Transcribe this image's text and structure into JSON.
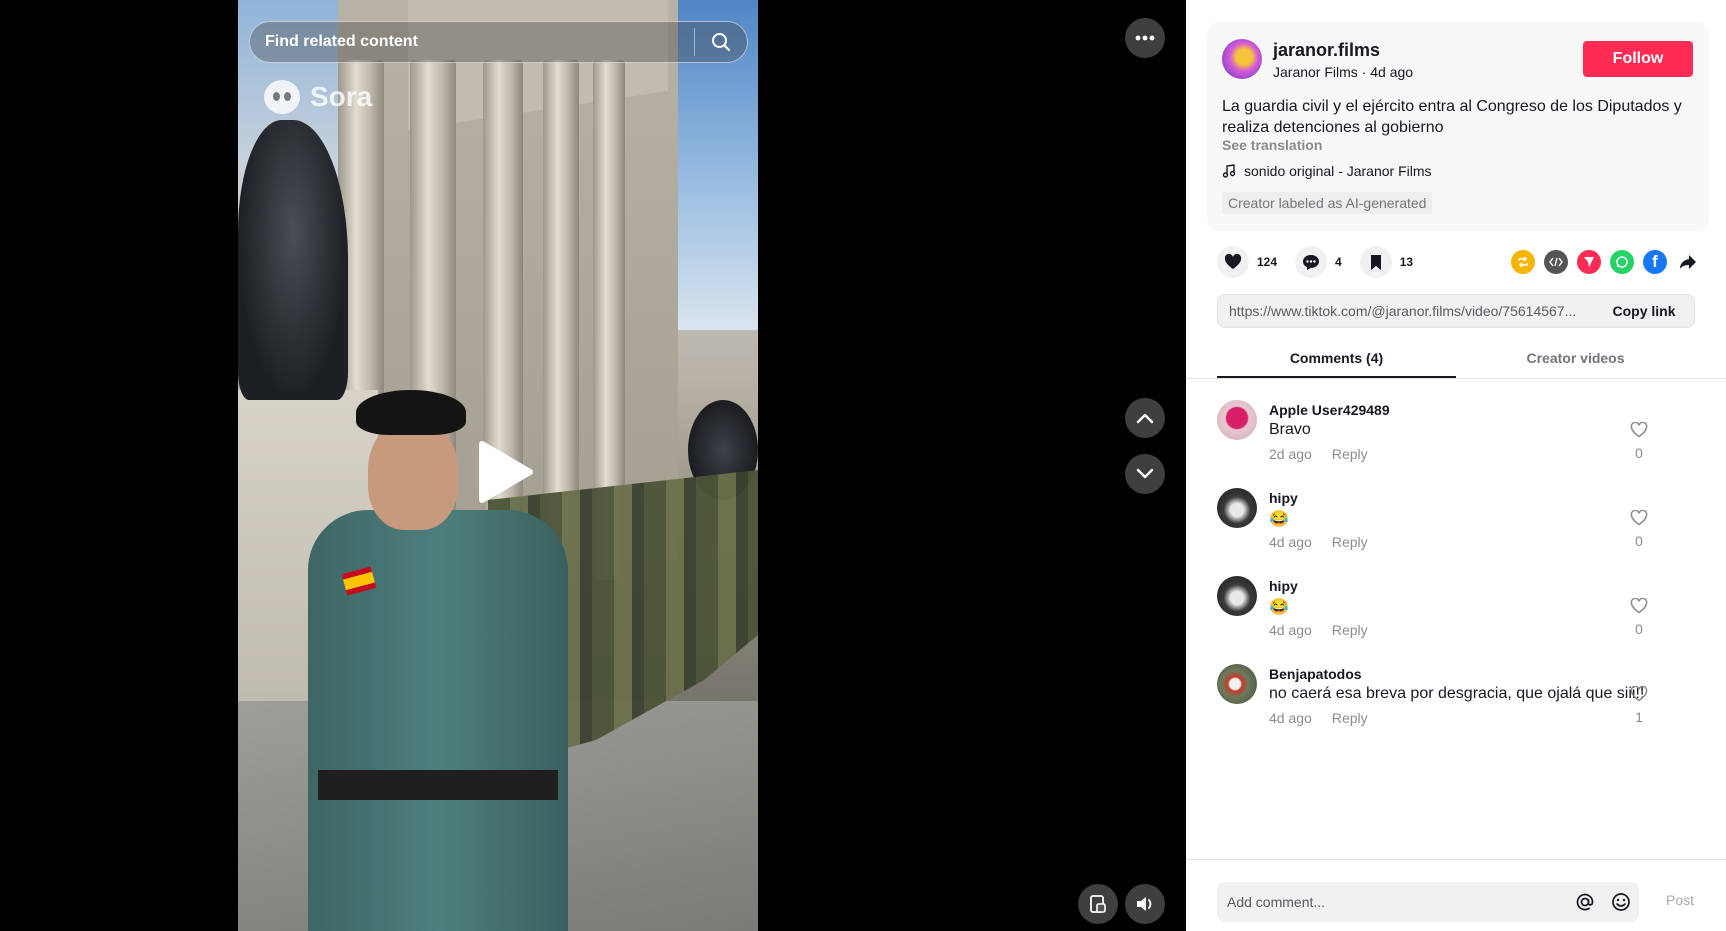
{
  "video": {
    "search_placeholder": "Find related content",
    "watermark": "Sora",
    "controls": {
      "more": "more-options",
      "prev": "previous-video",
      "next": "next-video",
      "pip": "picture-in-picture",
      "volume": "volume"
    }
  },
  "author": {
    "username": "jaranor.films",
    "meta": "Jaranor Films · 4d ago",
    "follow_label": "Follow"
  },
  "post": {
    "description": "La guardia civil y el ejército entra al Congreso de los Diputados y realiza detenciones al gobierno",
    "see_translation": "See translation",
    "music": "sonido original - Jaranor Films",
    "ai_label": "Creator labeled as AI-generated"
  },
  "stats": {
    "likes": "124",
    "comments": "4",
    "saves": "13"
  },
  "share": {
    "icons": [
      "repost-icon",
      "embed-icon",
      "send-icon",
      "whatsapp-icon",
      "facebook-icon",
      "share-arrow-icon"
    ],
    "colors": {
      "repost": "#f7b500",
      "embed": "#555555",
      "send": "#fe2c55",
      "whatsapp": "#25d366",
      "facebook": "#1877f2"
    }
  },
  "link": {
    "url": "https://www.tiktok.com/@jaranor.films/video/75614567...",
    "copy_label": "Copy link"
  },
  "tabs": [
    {
      "label": "Comments (4)",
      "active": true
    },
    {
      "label": "Creator videos",
      "active": false
    }
  ],
  "comments": [
    {
      "user": "Apple User429489",
      "text": "Bravo",
      "time": "2d ago",
      "reply": "Reply",
      "likes": "0"
    },
    {
      "user": "hipy",
      "text": "😂",
      "time": "4d ago",
      "reply": "Reply",
      "likes": "0"
    },
    {
      "user": "hipy",
      "text": "😂",
      "time": "4d ago",
      "reply": "Reply",
      "likes": "0"
    },
    {
      "user": "Benjapatodos",
      "text": "no caerá esa breva por desgracia, que ojalá que siii!!",
      "time": "4d ago",
      "reply": "Reply",
      "likes": "1"
    }
  ],
  "composer": {
    "placeholder": "Add comment...",
    "post_label": "Post"
  },
  "colors": {
    "accent": "#fe2c55",
    "text": "#161823",
    "muted": "#8a8b91"
  }
}
